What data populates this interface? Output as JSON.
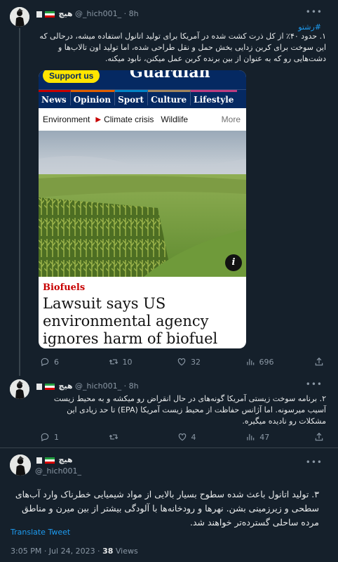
{
  "tweets": [
    {
      "name": "هیچ",
      "handle": "@_hich001_",
      "time": "8h",
      "hashtag": "#رشتو",
      "text": "۱. حدود ۴۰٪ از کل ذرت کشت شده در آمریکا برای تولید اتانول استفاده میشه، درحالی که این سوخت برای کربن زدایی بخش حمل و نقل طراحی شده، اما تولید اون تالاب‌ها و دشت‌هایی رو که به عنوان از بین برنده کربن عمل میکنن، نابود میکنه.",
      "replies": "6",
      "retweets": "10",
      "likes": "32",
      "views": "696"
    },
    {
      "name": "هیچ",
      "handle": "@_hich001_",
      "time": "8h",
      "text": "۲. برنامه سوخت زیستی آمریکا گونه‌های در حال انقراض رو میکشه و به محیط زیست آسیب میرسونه. اما آژانس حفاظت از محیط زیست آمریکا (EPA) تا حد زیادی این مشکلات رو نادیده میگیره.",
      "replies": "1",
      "retweets": "",
      "likes": "4",
      "views": "47"
    }
  ],
  "main_tweet": {
    "name": "هیچ",
    "handle": "@_hich001_",
    "text": "۳. تولید اتانول باعث شده سطوح بسیار بالایی از مواد شیمیایی خطرناک وارد آب‌های سطحی و زیرزمینی بشن. نهرها و رودخانه‌ها با آلودگی بیشتر از بین میرن و مناطق مرده ساحلی گسترده‌تر خواهند شد.",
    "translate": "Translate Tweet",
    "time": "3:05 PM · Jul 24, 2023 · ",
    "views_count": "38",
    "views_label": " Views"
  },
  "article": {
    "support": "Support us",
    "masthead": "Guardian",
    "nav": [
      "News",
      "Opinion",
      "Sport",
      "Culture",
      "Lifestyle"
    ],
    "nav_colors": [
      "#c70000",
      "#e05e00",
      "#0084c6",
      "#a1845c",
      "#bb3b80"
    ],
    "sub": [
      "Environment",
      "Climate crisis",
      "Wildlife",
      "More"
    ],
    "info": "i",
    "kicker": "Biofuels",
    "headline": "Lawsuit says US environmental agency ignores harm of biofuel"
  },
  "colors": {
    "bg": "#15202b",
    "text": "#e7e9ea",
    "muted": "#8b98a5",
    "accent": "#1d9bf0",
    "guardian_blue": "#052962",
    "guardian_red": "#c70000"
  },
  "icons": [
    "reply-icon",
    "retweet-icon",
    "like-icon",
    "views-icon",
    "share-icon",
    "more-icon",
    "iran-flag-icon",
    "black-flag-icon"
  ]
}
